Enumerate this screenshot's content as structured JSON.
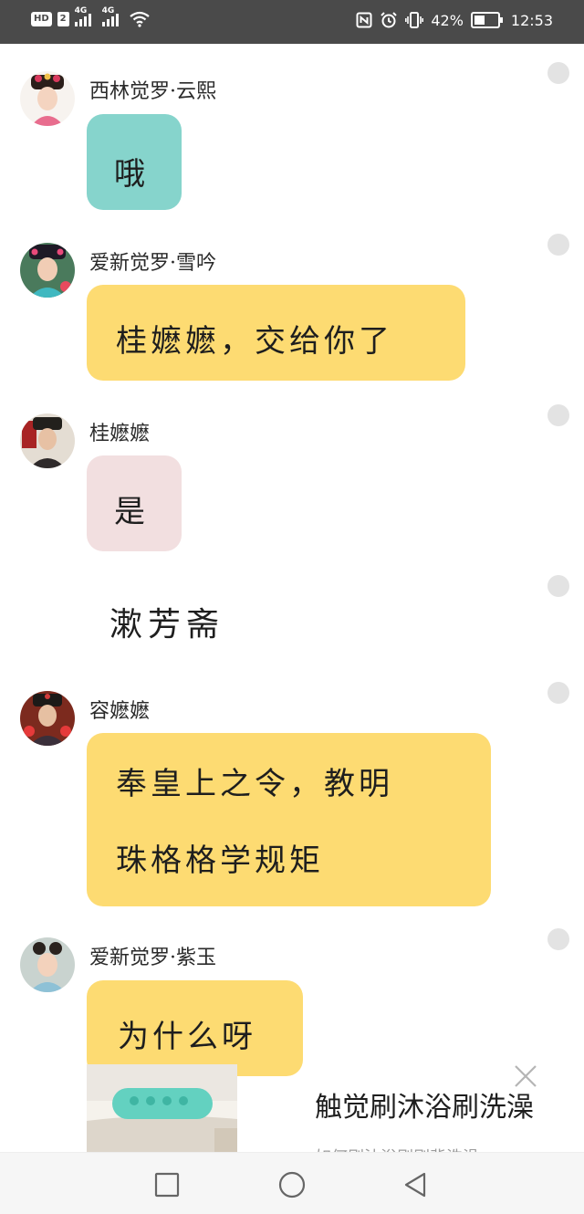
{
  "status_bar": {
    "hd_label": "HD",
    "sim_label": "2",
    "network_1": "4G",
    "network_2": "4G",
    "battery_percent": "42%",
    "time": "12:53",
    "icons": [
      "nfc-icon",
      "alarm-icon",
      "vibrate-icon",
      "battery-icon",
      "wifi-icon",
      "signal-icon"
    ]
  },
  "chat": {
    "messages": [
      {
        "speaker": "西林觉罗·云熙",
        "lines": [
          "哦"
        ],
        "bubble_color": "#86d4cc"
      },
      {
        "speaker": "爱新觉罗·雪吟",
        "lines": [
          "桂嬷嬷，交给你了"
        ],
        "bubble_color": "#fddb72"
      },
      {
        "speaker": "桂嬷嬷",
        "lines": [
          "是"
        ],
        "bubble_color": "#f2dfe0"
      },
      {
        "speaker": "容嬷嬷",
        "lines": [
          "奉皇上之令，教明",
          "珠格格学规矩"
        ],
        "bubble_color": "#fddb72"
      },
      {
        "speaker": "爱新觉罗·紫玉",
        "lines": [
          "为什么呀"
        ],
        "bubble_color": "#fddb72"
      }
    ],
    "scene_caption": "漱芳斋"
  },
  "ad": {
    "title": "触觉刷沐浴刷洗澡",
    "subtitle": "如何刷沐浴刷刷背洗澡"
  },
  "nav_bar": {
    "buttons": [
      "recents-square-icon",
      "home-circle-icon",
      "back-triangle-icon"
    ]
  }
}
